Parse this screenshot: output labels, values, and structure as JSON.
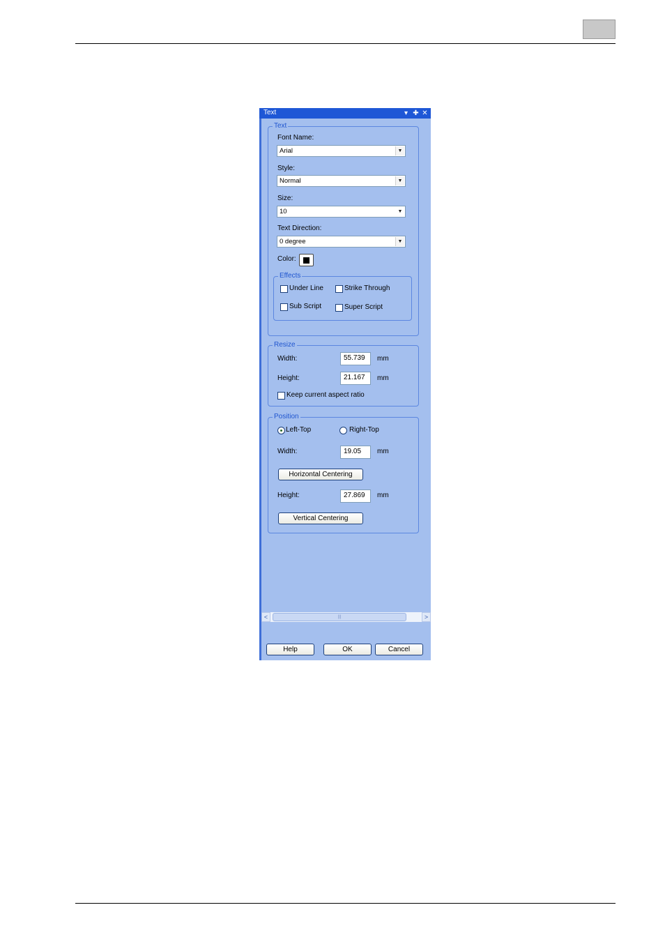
{
  "panel": {
    "title": "Text",
    "title_buttons": {
      "menu": "▾",
      "pin": "✚",
      "close": "✕"
    }
  },
  "text_group": {
    "legend": "Text",
    "font_name_label": "Font Name:",
    "font_name_value": "Arial",
    "style_label": "Style:",
    "style_value": "Normal",
    "size_label": "Size:",
    "size_value": "10",
    "direction_label": "Text Direction:",
    "direction_value": "0 degree",
    "color_label": "Color:",
    "effects": {
      "legend": "Effects",
      "under_line": "Under Line",
      "strike_through": "Strike Through",
      "sub_script": "Sub Script",
      "super_script": "Super Script"
    }
  },
  "resize_group": {
    "legend": "Resize",
    "width_label": "Width:",
    "width_value": "55.739",
    "height_label": "Height:",
    "height_value": "21.167",
    "unit": "mm",
    "keep_aspect": "Keep current aspect ratio"
  },
  "position_group": {
    "legend": "Position",
    "left_top": "Left-Top",
    "right_top": "Right-Top",
    "width_label": "Width:",
    "width_value": "19.05",
    "unit": "mm",
    "horizontal_centering": "Horizontal Centering",
    "height_label": "Height:",
    "height_value": "27.869",
    "vertical_centering": "Vertical Centering"
  },
  "scrollbar": {
    "left": "<",
    "right": ">",
    "grip": "|||"
  },
  "footer": {
    "help": "Help",
    "ok": "OK",
    "cancel": "Cancel"
  },
  "colors": {
    "panel_bg": "#a4bfee",
    "titlebar": "#1e57d6",
    "legend_text": "#1f55cf",
    "selected_color": "#000000"
  }
}
